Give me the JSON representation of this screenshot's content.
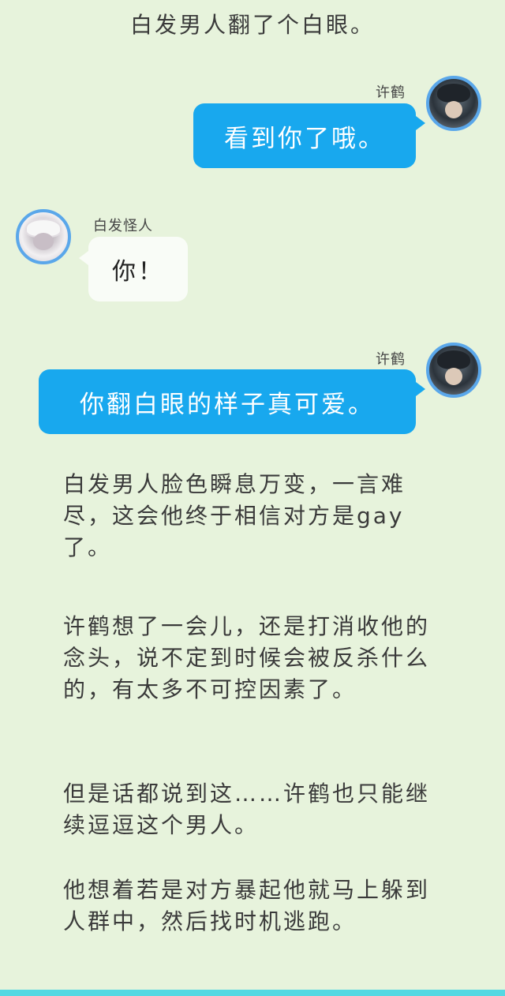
{
  "top_narration": "白发男人翻了个白眼。",
  "messages": [
    {
      "sender": "许鹤",
      "text": "看到你了哦。"
    },
    {
      "sender": "白发怪人",
      "text": "你！"
    },
    {
      "sender": "许鹤",
      "text": "你翻白眼的样子真可爱。"
    }
  ],
  "narration_paragraphs": [
    "白发男人脸色瞬息万变，一言难尽，这会他终于相信对方是gay了。",
    "许鹤想了一会儿，还是打消收他的念头，说不定到时候会被反杀什么的，有太多不可控因素了。",
    "但是话都说到这……许鹤也只能继续逗逗这个男人。",
    "他想着若是对方暴起他就马上躲到人群中，然后找时机逃跑。"
  ],
  "colors": {
    "background": "#e7f3dc",
    "right_bubble": "#18a8ee",
    "left_bubble": "#f9fcf7",
    "avatar_border": "#5aa7ea",
    "bottom_bar": "#55d8e2"
  }
}
